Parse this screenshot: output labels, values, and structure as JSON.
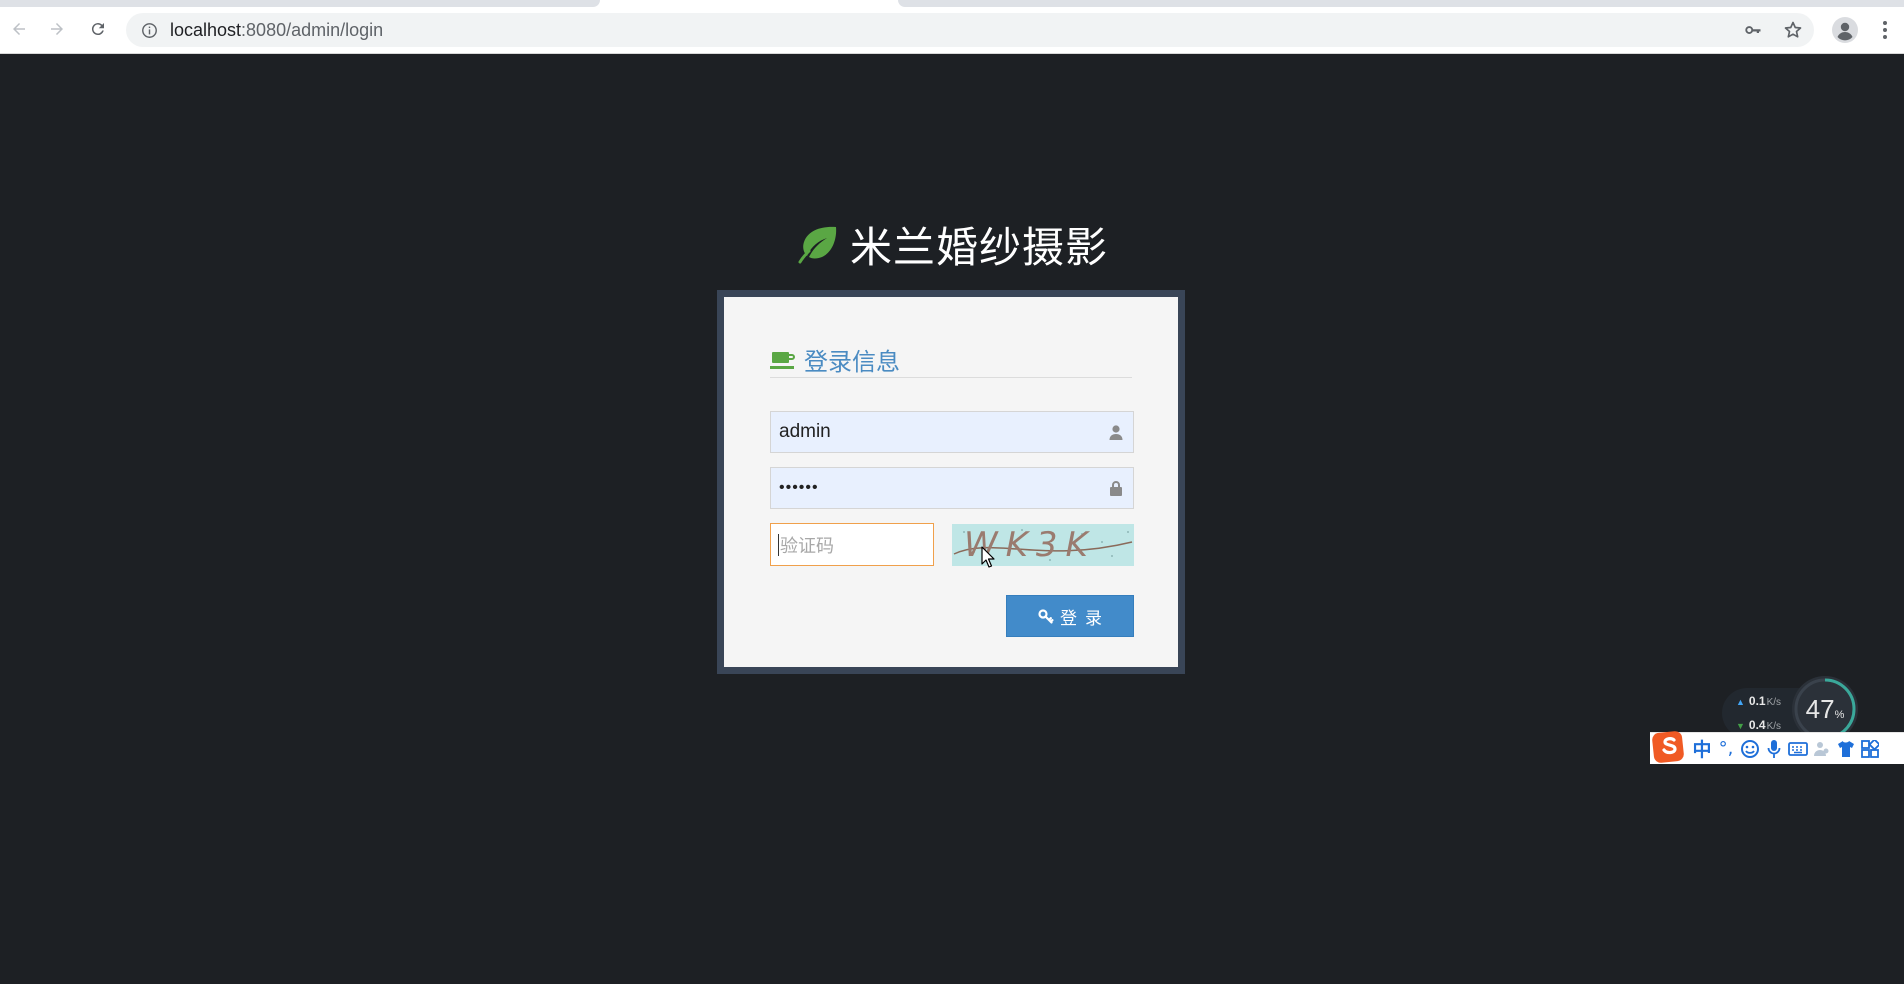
{
  "browser": {
    "url_host": "localhost",
    "url_path": ":8080/admin/login"
  },
  "brand": {
    "title": "米兰婚纱摄影",
    "icon": "leaf-icon",
    "icon_color": "#5aa744"
  },
  "login": {
    "header": "登录信息",
    "header_icon": "coffee-icon",
    "username": "admin",
    "password_mask": "••••••",
    "captcha_placeholder": "验证码",
    "captcha_text": "WK3K",
    "submit_label": "登录",
    "accent_color": "#428bca"
  },
  "netmon": {
    "up_value": "0.1",
    "up_unit": "K/s",
    "down_value": "0.4",
    "down_unit": "K/s",
    "percent": "47",
    "percent_symbol": "%"
  },
  "ime": {
    "mode": "中",
    "punct": "°,"
  }
}
